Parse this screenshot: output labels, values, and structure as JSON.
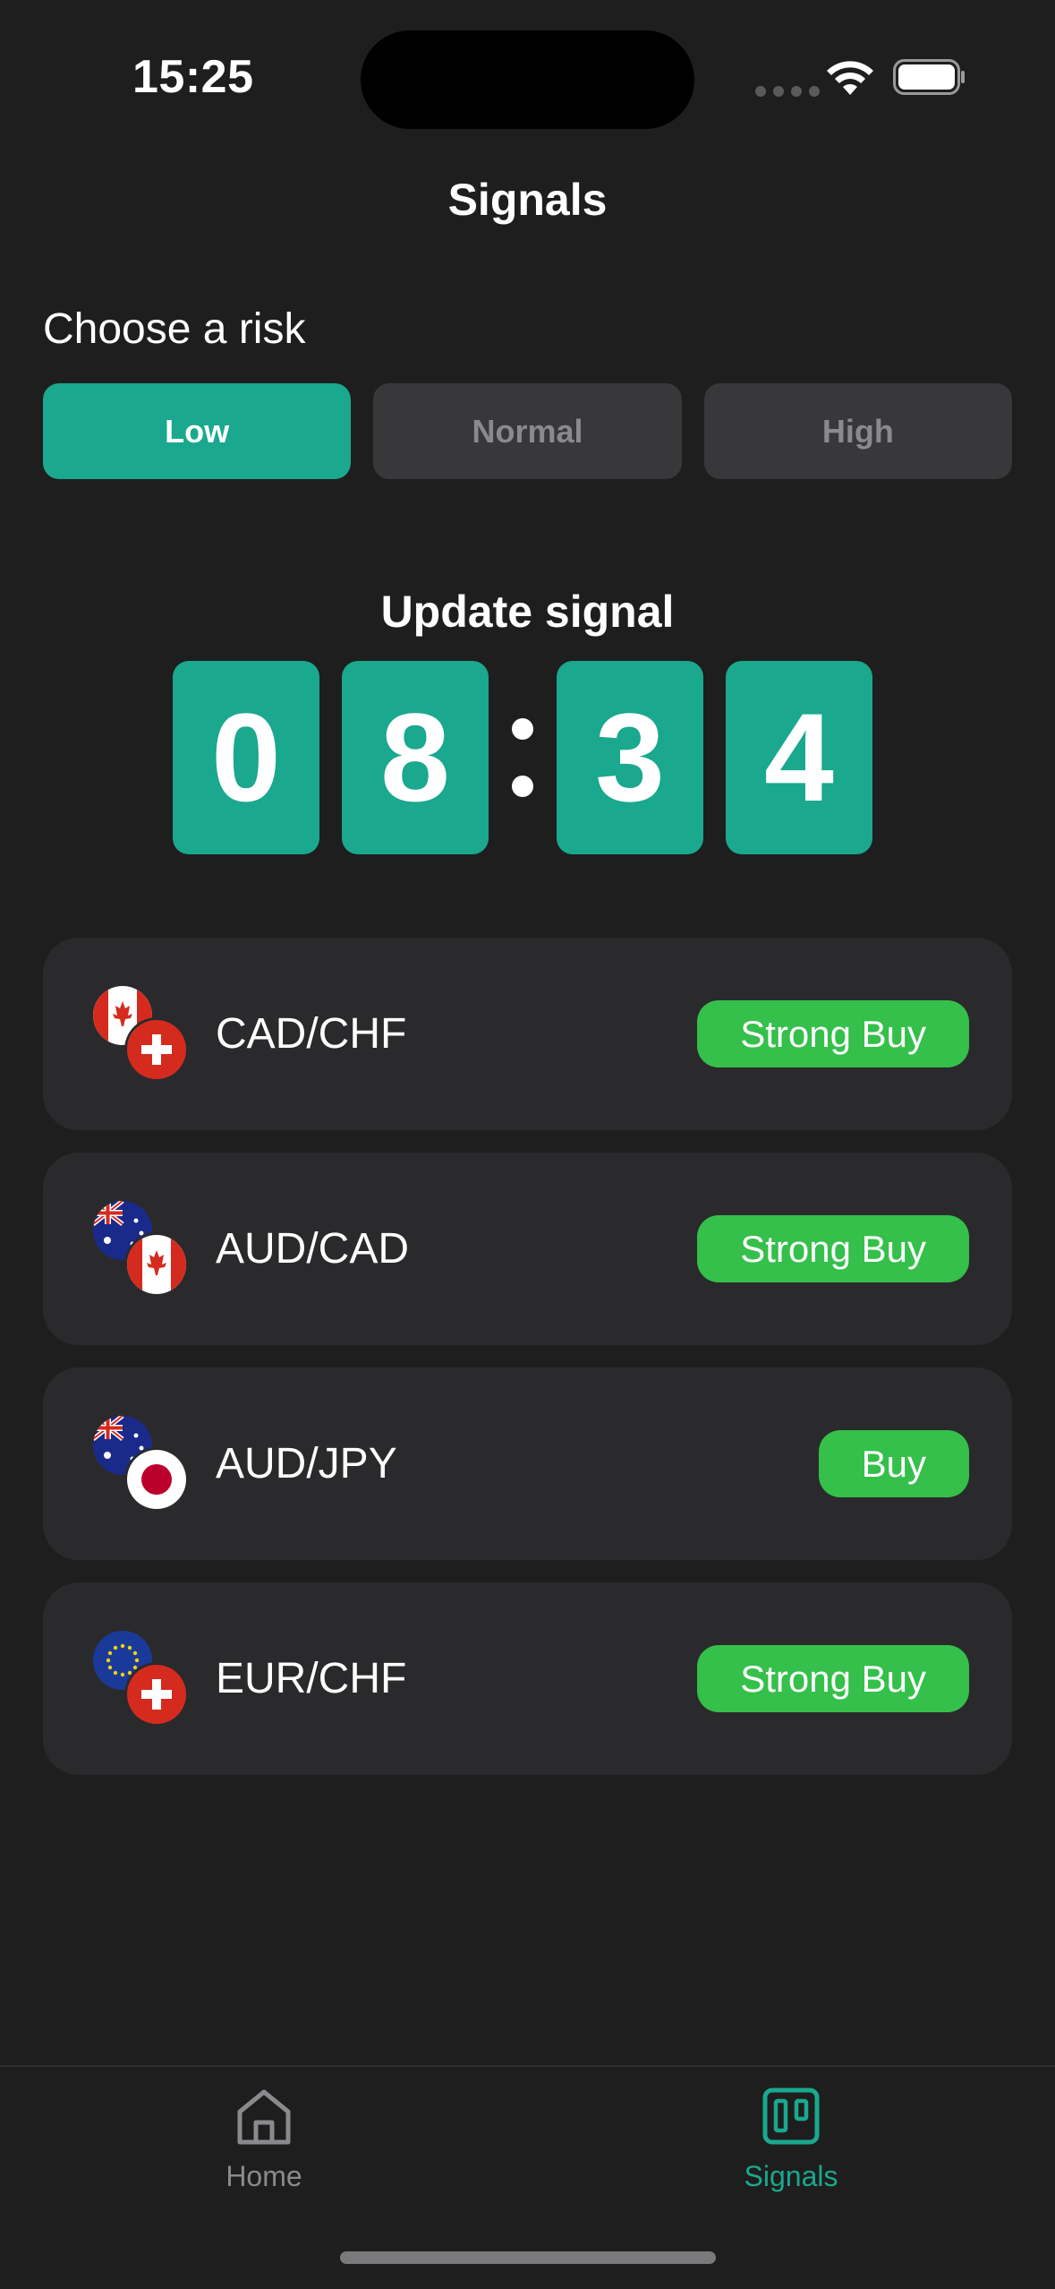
{
  "status_bar": {
    "time": "15:25"
  },
  "nav": {
    "title": "Signals"
  },
  "risk": {
    "label": "Choose a risk",
    "options": [
      "Low",
      "Normal",
      "High"
    ],
    "selected": "Low"
  },
  "timer": {
    "label": "Update signal",
    "digits": [
      "0",
      "8",
      "3",
      "4"
    ]
  },
  "signals": [
    {
      "pair": "CAD/CHF",
      "signal": "Strong Buy",
      "base_flag": "canada-flag-icon",
      "quote_flag": "switzerland-flag-icon"
    },
    {
      "pair": "AUD/CAD",
      "signal": "Strong Buy",
      "base_flag": "australia-flag-icon",
      "quote_flag": "canada-flag-icon"
    },
    {
      "pair": "AUD/JPY",
      "signal": "Buy",
      "base_flag": "australia-flag-icon",
      "quote_flag": "japan-flag-icon"
    },
    {
      "pair": "EUR/CHF",
      "signal": "Strong Buy",
      "base_flag": "eu-flag-icon",
      "quote_flag": "switzerland-flag-icon"
    }
  ],
  "tabbar": {
    "tabs": [
      {
        "label": "Home",
        "icon": "home-icon"
      },
      {
        "label": "Signals",
        "icon": "signals-board-icon"
      }
    ],
    "active": "Signals"
  },
  "colors": {
    "accent": "#1aa88e",
    "buy_green": "#34c04a",
    "background": "#1e1e1e",
    "card": "#2a2a2c"
  }
}
